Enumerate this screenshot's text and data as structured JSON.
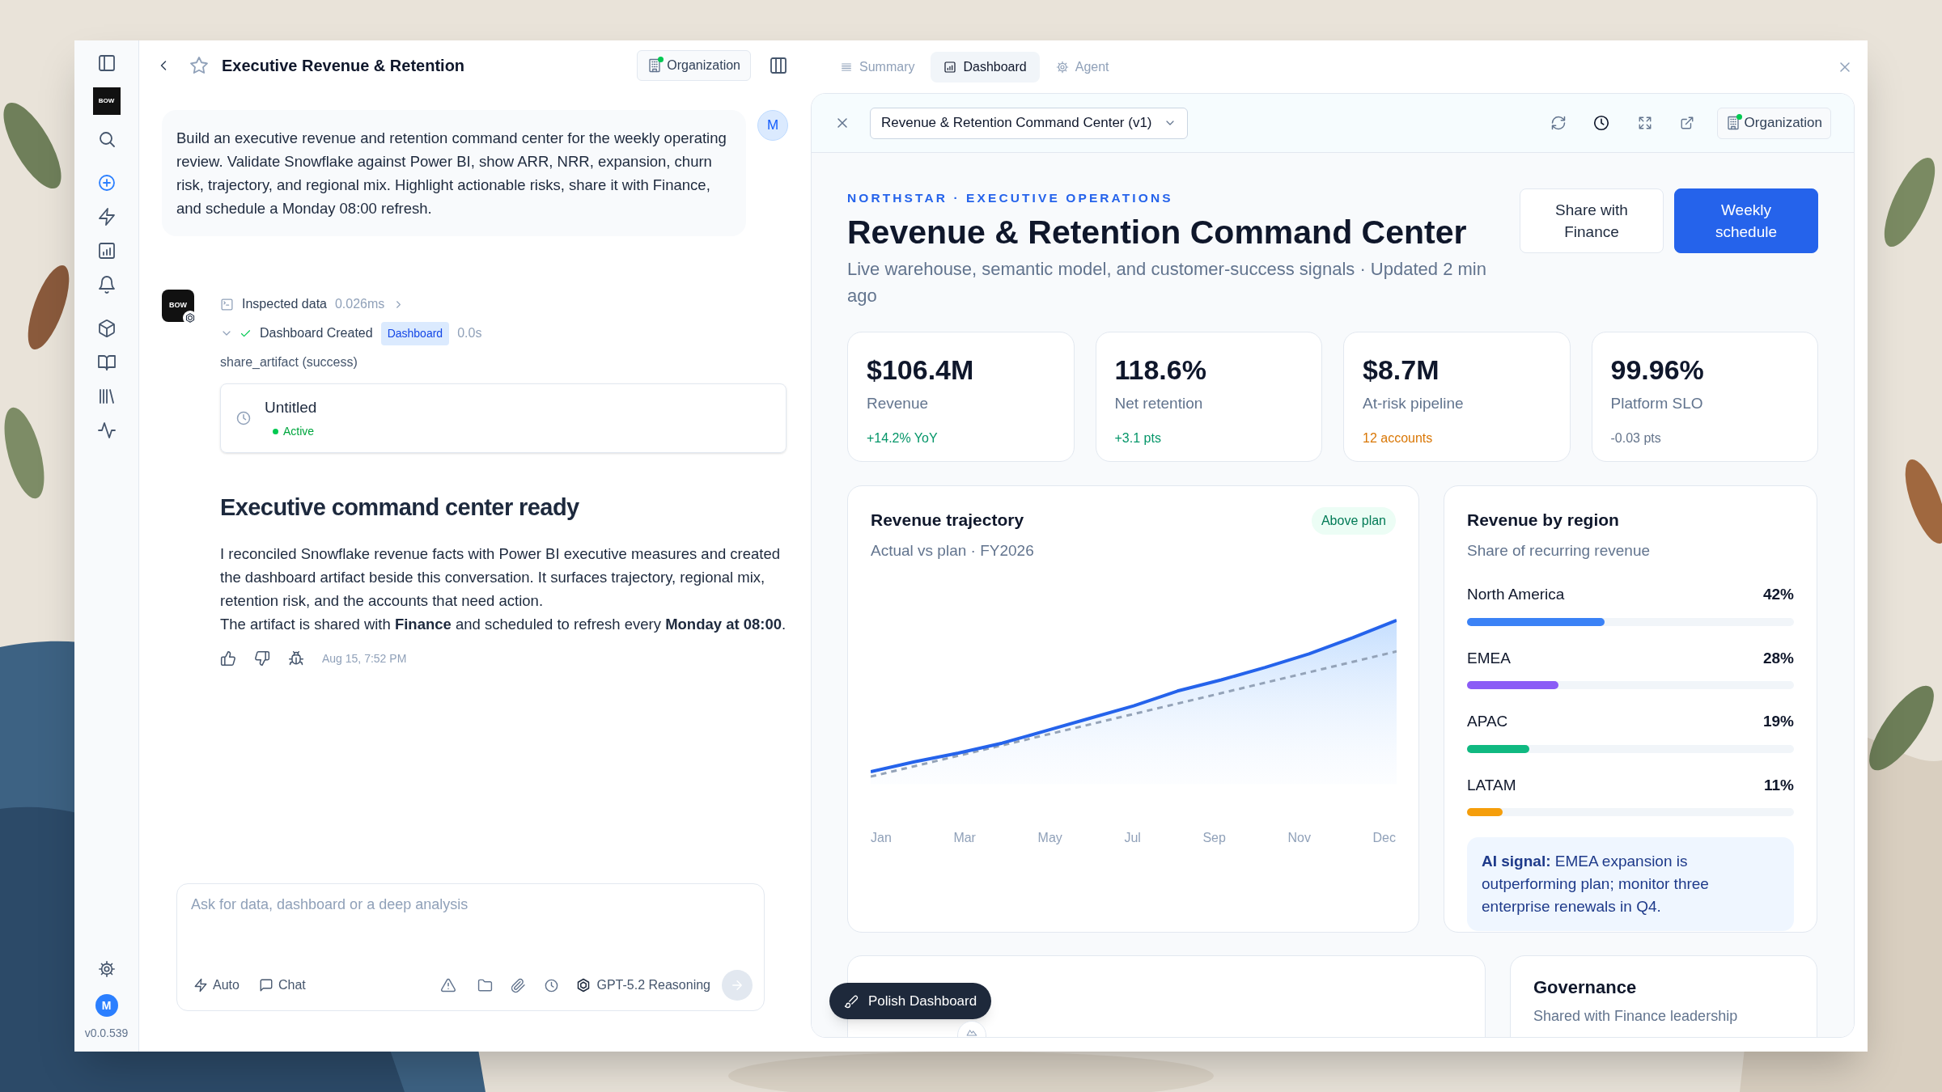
{
  "rail": {
    "items": [
      {
        "kind": "panel",
        "selected": false
      },
      {
        "kind": "logo",
        "label": "BOW",
        "selected": false
      },
      {
        "kind": "search",
        "selected": false
      },
      {
        "kind": "new",
        "selected": true
      },
      {
        "kind": "bolt",
        "selected": false
      },
      {
        "kind": "chart",
        "selected": false
      },
      {
        "kind": "bell",
        "selected": false
      },
      {
        "kind": "cube",
        "selected": false
      },
      {
        "kind": "book",
        "selected": false
      },
      {
        "kind": "library",
        "selected": false
      },
      {
        "kind": "activity",
        "selected": false
      }
    ],
    "avatar": "M",
    "version": "v0.0.539"
  },
  "chat": {
    "title": "Executive Revenue & Retention",
    "scope_button": "Organization",
    "user_message": {
      "text": "Build an executive revenue and retention command center for the weekly operating review. Validate Snowflake against Power BI, show ARR, NRR, expansion, churn risk, trajectory, and regional mix. Highlight actionable risks, share it with Finance, and schedule a Monday 08:00 refresh.",
      "avatar": "M"
    },
    "agent": {
      "avatar": "BOW",
      "steps": [
        {
          "kind": "inspect",
          "label": "Inspected data",
          "duration": "0.026ms"
        },
        {
          "kind": "created",
          "label": "Dashboard Created",
          "badge": "Dashboard",
          "duration": "0.0s"
        }
      ],
      "tool_result": "share_artifact (success)",
      "artifact": {
        "title": "Untitled",
        "status": "Active"
      },
      "heading": "Executive command center ready",
      "paragraphs": [
        "I reconciled Snowflake revenue facts with Power BI executive measures and created the dashboard artifact beside this conversation. It surfaces trajectory, regional mix, retention risk, and the accounts that need action.",
        "The artifact is shared with **Finance** and scheduled to refresh every **Monday at 08:00**."
      ],
      "timestamp": "Aug 15, 7:52 PM"
    },
    "composer": {
      "placeholder": "Ask for data, dashboard or a deep analysis",
      "mode": "Auto",
      "chat": "Chat",
      "model": "GPT-5.2 Reasoning"
    }
  },
  "tabs": [
    {
      "label": "Summary",
      "kind": "summary",
      "selected": false
    },
    {
      "label": "Dashboard",
      "kind": "dashboard",
      "selected": true
    },
    {
      "label": "Agent",
      "kind": "agent",
      "selected": false
    }
  ],
  "artifact_bar": {
    "version_select": "Revenue & Retention Command Center (v1)",
    "scope_button": "Organization"
  },
  "dashboard": {
    "eyebrow": "NORTHSTAR · EXECUTIVE OPERATIONS",
    "title": "Revenue & Retention Command Center",
    "subtitle": "Live warehouse, semantic model, and customer-success signals · Updated 2 min ago",
    "buttons": [
      {
        "label": "Share with Finance",
        "kind": "secondary"
      },
      {
        "label": "Weekly schedule",
        "kind": "primary"
      }
    ],
    "kpis": [
      {
        "value": "$106.4M",
        "label": "Revenue",
        "delta": "+14.2% YoY",
        "color": "#059669"
      },
      {
        "value": "118.6%",
        "label": "Net retention",
        "delta": "+3.1 pts",
        "color": "#059669"
      },
      {
        "value": "$8.7M",
        "label": "At-risk pipeline",
        "delta": "12 accounts",
        "color": "#d97706"
      },
      {
        "value": "99.96%",
        "label": "Platform SLO",
        "delta": "-0.03 pts",
        "color": "#64748b"
      }
    ],
    "trajectory": {
      "title": "Revenue trajectory",
      "subtitle": "Actual vs plan · FY2026",
      "badge": "Above plan",
      "x_labels": [
        "Jan",
        "Mar",
        "May",
        "Jul",
        "Sep",
        "Nov",
        "Dec"
      ]
    },
    "regions": {
      "title": "Revenue by region",
      "subtitle": "Share of recurring revenue",
      "items": [
        {
          "name": "North America",
          "share": "42%",
          "level": 0.42,
          "color": "#3b82f6"
        },
        {
          "name": "EMEA",
          "share": "28%",
          "level": 0.28,
          "color": "#8b5cf6"
        },
        {
          "name": "APAC",
          "share": "19%",
          "level": 0.19,
          "color": "#10b981"
        },
        {
          "name": "LATAM",
          "share": "11%",
          "level": 0.11,
          "color": "#f59e0b"
        }
      ],
      "signal": "**AI signal:** EMEA expansion is outperforming plan; monitor three enterprise renewals in Q4."
    },
    "governance": {
      "title": "Governance",
      "subtitle": "Shared with Finance leadership"
    },
    "polish_button": "Polish Dashboard"
  }
}
